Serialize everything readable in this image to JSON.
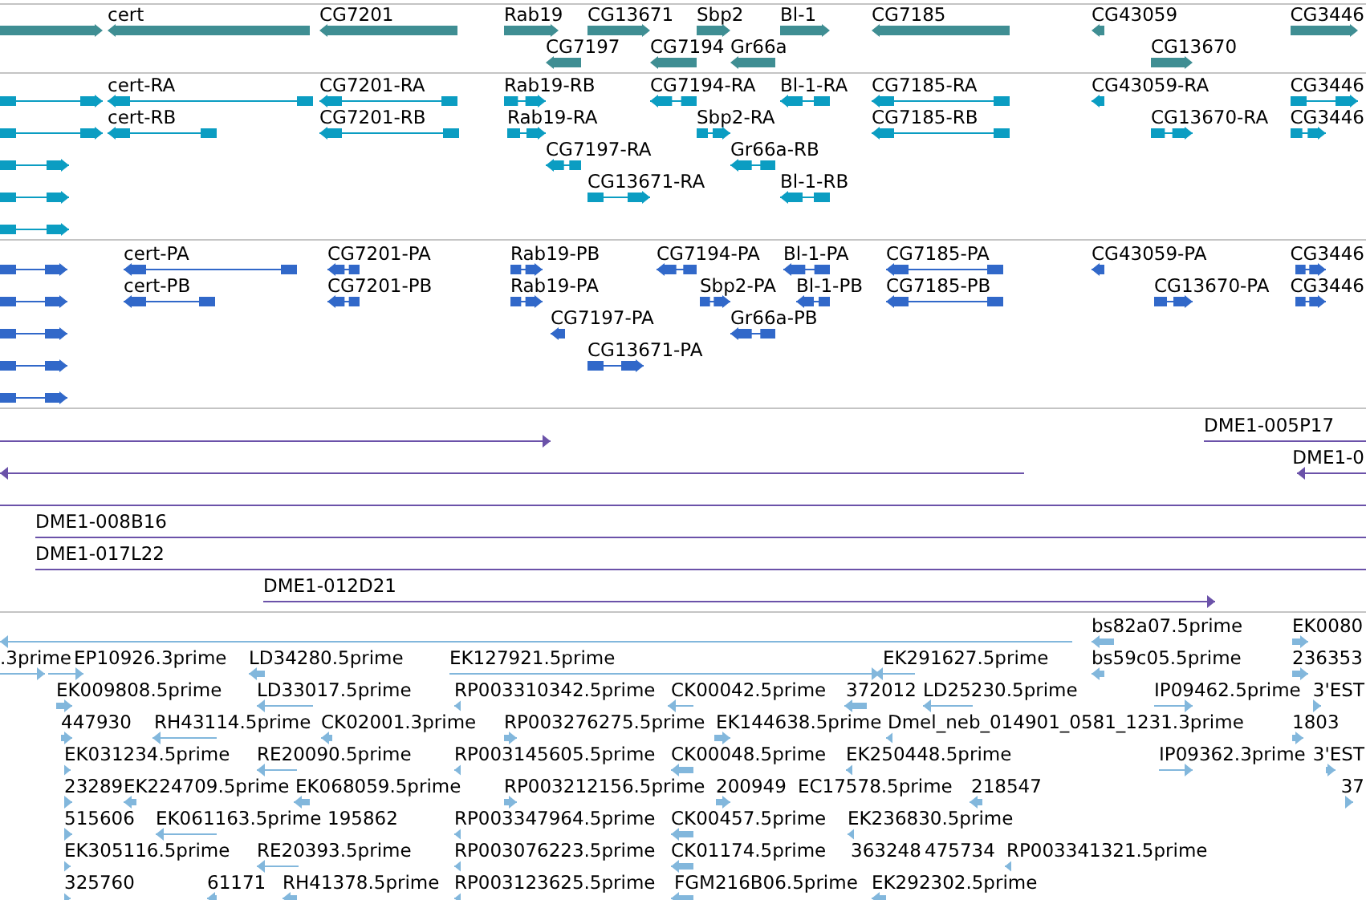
{
  "tracks": [
    {
      "kind": "gene",
      "lanes": [
        [
          {
            "reverse": false
          },
          {
            "label": "cert",
            "reverse": true
          },
          {
            "label": "CG7201",
            "reverse": true
          },
          {
            "label": "Rab19",
            "reverse": false
          },
          {
            "label": "CG13671",
            "reverse": false
          },
          {
            "label": "Sbp2",
            "reverse": false
          },
          {
            "label": "Bl-1",
            "reverse": false
          },
          {
            "label": "CG7185",
            "reverse": true
          },
          {
            "label": "CG43059",
            "reverse": true
          },
          {
            "label": "CG3446",
            "reverse": false
          }
        ],
        [
          {
            "label": "CG7197",
            "reverse": true
          },
          {
            "label": "CG7194",
            "reverse": true
          },
          {
            "label": "Gr66a",
            "reverse": true
          },
          {
            "label": "CG13670",
            "reverse": false
          }
        ]
      ]
    },
    {
      "kind": "transcript",
      "lanes": [
        [
          {
            "reverse": false
          },
          {
            "label": "cert-RA",
            "reverse": true
          },
          {
            "label": "CG7201-RA",
            "reverse": true
          },
          {
            "label": "Rab19-RB",
            "reverse": false
          },
          {
            "label": "CG7194-RA",
            "reverse": true
          },
          {
            "label": "Bl-1-RA",
            "reverse": true
          },
          {
            "label": "CG7185-RA",
            "reverse": true
          },
          {
            "label": "CG43059-RA",
            "reverse": true
          },
          {
            "label": "CG3446",
            "reverse": false
          }
        ],
        [
          {
            "reverse": false
          },
          {
            "label": "cert-RB",
            "reverse": true
          },
          {
            "label": "CG7201-RB",
            "reverse": true
          },
          {
            "label": "Rab19-RA",
            "reverse": false
          },
          {
            "label": "Sbp2-RA",
            "reverse": false
          },
          {
            "label": "CG7185-RB",
            "reverse": true
          },
          {
            "label": "CG13670-RA",
            "reverse": false
          },
          {
            "label": "CG3446",
            "reverse": false
          }
        ],
        [
          {
            "reverse": false
          },
          {
            "label": "CG7197-RA",
            "reverse": true
          },
          {
            "label": "Gr66a-RB",
            "reverse": true
          }
        ],
        [
          {
            "reverse": false
          },
          {
            "label": "CG13671-RA",
            "reverse": false
          },
          {
            "label": "Bl-1-RB",
            "reverse": true
          }
        ],
        [
          {
            "reverse": false
          }
        ]
      ]
    },
    {
      "kind": "protein",
      "lanes": [
        [
          {
            "reverse": false
          },
          {
            "label": "cert-PA",
            "reverse": true
          },
          {
            "label": "CG7201-PA",
            "reverse": true
          },
          {
            "label": "Rab19-PB",
            "reverse": false
          },
          {
            "label": "CG7194-PA",
            "reverse": true
          },
          {
            "label": "Bl-1-PA",
            "reverse": true
          },
          {
            "label": "CG7185-PA",
            "reverse": true
          },
          {
            "label": "CG43059-PA",
            "reverse": true
          },
          {
            "label": "CG3446",
            "reverse": false
          }
        ],
        [
          {
            "reverse": false
          },
          {
            "label": "cert-PB",
            "reverse": true
          },
          {
            "label": "CG7201-PB",
            "reverse": true
          },
          {
            "label": "Rab19-PA",
            "reverse": false
          },
          {
            "label": "Sbp2-PA",
            "reverse": false
          },
          {
            "label": "Bl-1-PB",
            "reverse": true
          },
          {
            "label": "CG7185-PB",
            "reverse": true
          },
          {
            "label": "CG13670-PA",
            "reverse": false
          },
          {
            "label": "CG3446",
            "reverse": false
          }
        ],
        [
          {
            "reverse": false
          },
          {
            "label": "CG7197-PA",
            "reverse": true
          },
          {
            "label": "Gr66a-PB",
            "reverse": true
          }
        ],
        [
          {
            "reverse": false
          },
          {
            "label": "CG13671-PA",
            "reverse": false
          }
        ],
        [
          {
            "reverse": false
          }
        ]
      ]
    },
    {
      "kind": "clone",
      "lanes": [
        [
          {
            "reverse": false
          },
          {
            "label": "DME1-005P17",
            "reverse": false
          }
        ],
        [
          {
            "reverse": true
          },
          {
            "label": "DME1-0",
            "reverse": true
          }
        ],
        [
          {
            "reverse": false
          }
        ],
        [
          {
            "label": "DME1-008B16",
            "reverse": false
          }
        ],
        [
          {
            "label": "DME1-017L22",
            "reverse": false
          }
        ],
        [
          {
            "label": "DME1-012D21",
            "reverse": false
          }
        ]
      ]
    },
    {
      "kind": "est",
      "lanes": [
        [
          {
            "reverse": true
          },
          {
            "label": "bs82a07.5prime",
            "reverse": true
          },
          {
            "label": "EK0080",
            "reverse": false
          }
        ],
        [
          {
            "label": ".3prime",
            "reverse": false
          },
          {
            "label": "EP10926.3prime",
            "reverse": false
          },
          {
            "label": "LD34280.5prime",
            "reverse": true
          },
          {
            "label": "EK127921.5prime",
            "reverse": false
          },
          {
            "label": "EK291627.5prime",
            "reverse": true
          },
          {
            "label": "bs59c05.5prime",
            "reverse": true
          },
          {
            "label": "236353",
            "reverse": false
          }
        ],
        [
          {
            "label": "EK009808.5prime",
            "reverse": false
          },
          {
            "label": "LD33017.5prime",
            "reverse": true
          },
          {
            "label": "RP003310342.5prime",
            "reverse": true
          },
          {
            "label": "CK00042.5prime",
            "reverse": true
          },
          {
            "label": "372012",
            "reverse": true
          },
          {
            "label": "LD25230.5prime",
            "reverse": true
          },
          {
            "label": "IP09462.5prime",
            "reverse": false
          },
          {
            "label": "3'EST",
            "reverse": false
          }
        ],
        [
          {
            "label": "447930",
            "reverse": false
          },
          {
            "label": "RH43114.5prime",
            "reverse": true
          },
          {
            "label": "CK02001.3prime",
            "reverse": true
          },
          {
            "label": "RP003276275.5prime",
            "reverse": false
          },
          {
            "label": "EK144638.5prime",
            "reverse": false
          },
          {
            "label": "Dmel_neb_014901_0581_1231.3prime",
            "reverse": true
          },
          {
            "label": "1803",
            "reverse": false
          }
        ],
        [
          {
            "label": "EK031234.5prime",
            "reverse": false
          },
          {
            "label": "RE20090.5prime",
            "reverse": true
          },
          {
            "label": "RP003145605.5prime",
            "reverse": true
          },
          {
            "label": "CK00048.5prime",
            "reverse": true
          },
          {
            "label": "EK250448.5prime",
            "reverse": true
          },
          {
            "label": "IP09362.3prime",
            "reverse": false
          },
          {
            "label": "3'EST",
            "reverse": false
          }
        ],
        [
          {
            "label": "23289",
            "reverse": false
          },
          {
            "label": "EK224709.5prime",
            "reverse": true
          },
          {
            "label": "EK068059.5prime",
            "reverse": true
          },
          {
            "label": "RP003212156.5prime",
            "reverse": false
          },
          {
            "label": "200949",
            "reverse": false
          },
          {
            "label": "EC17578.5prime"
          },
          {
            "label": "218547",
            "reverse": true
          },
          {
            "label": "37",
            "reverse": false
          }
        ],
        [
          {
            "label": "515606",
            "reverse": false
          },
          {
            "label": "EK061163.5prime",
            "reverse": true
          },
          {
            "label": "195862"
          },
          {
            "label": "RP003347964.5prime",
            "reverse": true
          },
          {
            "label": "CK00457.5prime",
            "reverse": true
          },
          {
            "label": "EK236830.5prime",
            "reverse": true
          }
        ],
        [
          {
            "label": "EK305116.5prime",
            "reverse": false
          },
          {
            "label": "RE20393.5prime",
            "reverse": true
          },
          {
            "label": "RP003076223.5prime",
            "reverse": true
          },
          {
            "label": "CK01174.5prime",
            "reverse": true
          },
          {
            "label": "363248"
          },
          {
            "label": "475734"
          },
          {
            "label": "RP003341321.5prime",
            "reverse": true
          }
        ],
        [
          {
            "label": "325760",
            "reverse": false
          },
          {
            "label": "61171",
            "reverse": true
          },
          {
            "label": "RH41378.5prime",
            "reverse": true
          },
          {
            "label": "RP003123625.5prime",
            "reverse": true
          },
          {
            "label": "FGM216B06.5prime",
            "reverse": true
          },
          {
            "label": "EK292302.5prime",
            "reverse": true
          }
        ]
      ]
    }
  ]
}
